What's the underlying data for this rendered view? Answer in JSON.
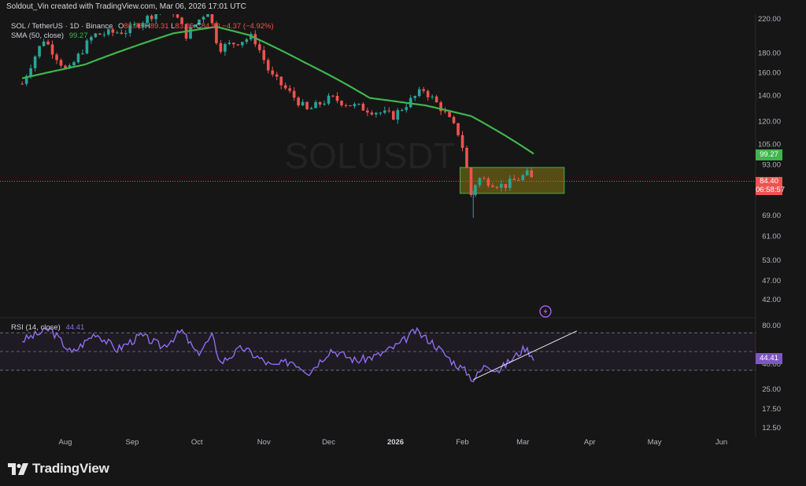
{
  "header": {
    "creator_line": "Soldout_Vin created with TradingView.com, Mar 06, 2026 17:01 UTC"
  },
  "legend": {
    "symbol": "SOL / TetherUS · 1D · Binance",
    "ohlc": {
      "open_label": "O",
      "open": "88.78",
      "high_label": "H",
      "high": "89.31",
      "low_label": "L",
      "low": "83.06",
      "close_label": "C",
      "close": "84.40",
      "change": "−4.37 (−4.92%)"
    },
    "sma_label": "SMA (50, close)",
    "sma_value": "99.27",
    "rsi_label": "RSI (14, close)",
    "rsi_value": "44.41"
  },
  "watermark": "SOLUSDT",
  "price_tags": {
    "sma": "99.27",
    "last": "84.40",
    "countdown": "06:58:57",
    "rsi": "44.41"
  },
  "footer": {
    "brand": "TradingView"
  },
  "colors": {
    "up": "#26a69a",
    "down": "#ef5350",
    "sma": "#3fb54c",
    "rsi": "#8f6cf0",
    "zone_fill": "#8a7d14",
    "zone_border": "#3fb54c"
  },
  "icons": {
    "alert": "lightning-icon",
    "logo": "tradingview-logo-icon"
  },
  "chart_data": {
    "type": "candlestick",
    "price_axis": {
      "scale": "log",
      "ticks": [
        "220.00",
        "180.00",
        "160.00",
        "140.00",
        "120.00",
        "105.00",
        "93.00",
        "69.00",
        "61.00",
        "53.00",
        "47.00",
        "42.00"
      ]
    },
    "time_axis": {
      "labels": [
        "Aug",
        "Sep",
        "Oct",
        "Nov",
        "Dec",
        "2026",
        "Feb",
        "Mar",
        "Apr",
        "May",
        "Jun"
      ]
    },
    "price_path": [
      [
        "2025-07-12",
        150
      ],
      [
        "2025-07-22",
        195
      ],
      [
        "2025-08-02",
        160
      ],
      [
        "2025-08-14",
        200
      ],
      [
        "2025-08-30",
        205
      ],
      [
        "2025-09-18",
        240
      ],
      [
        "2025-09-26",
        200
      ],
      [
        "2025-10-06",
        232
      ],
      [
        "2025-10-11",
        185
      ],
      [
        "2025-10-27",
        198
      ],
      [
        "2025-11-04",
        158
      ],
      [
        "2025-11-21",
        128
      ],
      [
        "2025-12-02",
        138
      ],
      [
        "2025-12-12",
        132
      ],
      [
        "2025-12-31",
        124
      ],
      [
        "2026-01-14",
        145
      ],
      [
        "2026-01-22",
        130
      ],
      [
        "2026-01-31",
        110
      ],
      [
        "2026-02-05",
        78
      ],
      [
        "2026-02-08",
        86
      ],
      [
        "2026-02-20",
        82
      ],
      [
        "2026-03-03",
        88
      ],
      [
        "2026-03-06",
        84.4
      ]
    ],
    "sma_path": [
      [
        "2025-07-12",
        155
      ],
      [
        "2025-08-10",
        168
      ],
      [
        "2025-09-20",
        202
      ],
      [
        "2025-10-10",
        210
      ],
      [
        "2025-10-25",
        200
      ],
      [
        "2025-11-20",
        170
      ],
      [
        "2025-12-20",
        138
      ],
      [
        "2026-01-15",
        132
      ],
      [
        "2026-02-05",
        124
      ],
      [
        "2026-03-06",
        99.27
      ]
    ],
    "consolidation_zone": {
      "start": "2026-02-05",
      "end": "2026-03-26",
      "low": 78.6,
      "high": 91.6
    },
    "current_price": 84.4,
    "sma_current": 99.27,
    "rsi": {
      "levels": [
        70,
        50,
        30
      ],
      "axis_ticks": [
        "80.00",
        "40.00",
        "25.00",
        "17.50",
        "12.50"
      ],
      "path": [
        [
          "2025-07-12",
          62
        ],
        [
          "2025-07-25",
          74
        ],
        [
          "2025-08-04",
          48
        ],
        [
          "2025-08-15",
          70
        ],
        [
          "2025-08-25",
          52
        ],
        [
          "2025-09-05",
          67
        ],
        [
          "2025-09-15",
          55
        ],
        [
          "2025-09-24",
          72
        ],
        [
          "2025-10-01",
          47
        ],
        [
          "2025-10-08",
          66
        ],
        [
          "2025-10-12",
          38
        ],
        [
          "2025-10-22",
          54
        ],
        [
          "2025-11-05",
          34
        ],
        [
          "2025-11-14",
          40
        ],
        [
          "2025-11-22",
          28
        ],
        [
          "2025-12-02",
          52
        ],
        [
          "2025-12-14",
          40
        ],
        [
          "2025-12-24",
          46
        ],
        [
          "2026-01-03",
          58
        ],
        [
          "2026-01-10",
          72
        ],
        [
          "2026-01-18",
          60
        ],
        [
          "2026-01-27",
          40
        ],
        [
          "2026-02-03",
          28
        ],
        [
          "2026-02-06",
          20
        ],
        [
          "2026-02-12",
          36
        ],
        [
          "2026-02-18",
          30
        ],
        [
          "2026-02-26",
          46
        ],
        [
          "2026-03-02",
          54
        ],
        [
          "2026-03-06",
          44.41
        ]
      ],
      "trendline": [
        [
          "2026-02-06",
          20
        ],
        [
          "2026-03-26",
          72
        ]
      ],
      "current": 44.41
    }
  }
}
